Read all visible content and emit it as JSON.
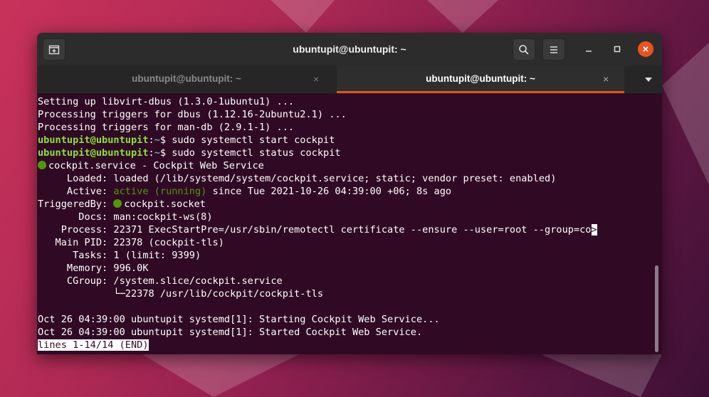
{
  "window": {
    "title": "ubuntupit@ubuntupit: ~"
  },
  "tabs": [
    {
      "label": "ubuntupit@ubuntupit: ~",
      "close": "×",
      "active": false
    },
    {
      "label": "ubuntupit@ubuntupit: ~",
      "close": "×",
      "active": true
    }
  ],
  "colors": {
    "accent": "#e95420",
    "terminal_bg": "#300a24",
    "prompt_user": "#8ae234",
    "prompt_path": "#729fcf",
    "status_green": "#4e9a06"
  },
  "terminal": {
    "lines": [
      "Setting up libvirt-dbus (1.3.0-1ubuntu1) ...",
      "Processing triggers for dbus (1.12.16-2ubuntu2.1) ...",
      "Processing triggers for man-db (2.9.1-1) ..."
    ],
    "prompt_user": "ubuntupit@ubuntupit",
    "prompt_sep": ":",
    "prompt_path": "~",
    "prompt_dollar": "$ ",
    "cmd1": "sudo systemctl start cockpit",
    "cmd2": "sudo systemctl status cockpit",
    "service_line": "cockpit.service - Cockpit Web Service",
    "loaded": "     Loaded: loaded (/lib/systemd/system/cockpit.service; static; vendor preset: enabled)",
    "active_label": "     Active: ",
    "active_state": "active (running)",
    "active_rest": " since Tue 2021-10-26 04:39:00 +06; 8s ago",
    "triggered_label": "TriggeredBy: ",
    "triggered_value": "cockpit.socket",
    "docs": "       Docs: man:cockpit-ws(8)",
    "process": "    Process: 22371 ExecStartPre=/usr/sbin/remotectl certificate --ensure --user=root --group=co",
    "truncate_marker": ">",
    "mainpid": "   Main PID: 22378 (cockpit-tls)",
    "tasks": "      Tasks: 1 (limit: 9399)",
    "memory": "     Memory: 996.0K",
    "cgroup": "     CGroup: /system.slice/cockpit.service",
    "cgroup_child": "             └─22378 /usr/lib/cockpit/cockpit-tls",
    "log1": "Oct 26 04:39:00 ubuntupit systemd[1]: Starting Cockpit Web Service...",
    "log2": "Oct 26 04:39:00 ubuntupit systemd[1]: Started Cockpit Web Service.",
    "pager": "lines 1-14/14 (END)"
  }
}
